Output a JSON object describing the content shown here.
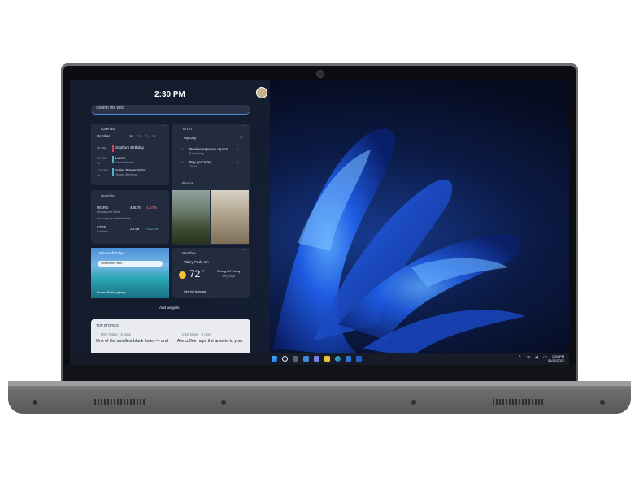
{
  "widgets": {
    "time": "2:30 PM",
    "search_placeholder": "Search the web",
    "calendar": {
      "title": "Calendar",
      "month": "October",
      "dates": [
        "20",
        "21",
        "22",
        "23"
      ],
      "events": [
        {
          "when": "All day",
          "title": "Sophia's Birthday",
          "sub": "",
          "color": "#c8465a"
        },
        {
          "when": "12 PM",
          "dur": "1h",
          "title": "Lunch",
          "sub": "Omar Bennet",
          "color": "#4fb3c9"
        },
        {
          "when": "1:30 PM",
          "dur": "1h",
          "title": "Sales Presentation",
          "sub": "Teams Meeting",
          "color": "#4fb3c9"
        }
      ]
    },
    "todo": {
      "title": "To Do",
      "list": "My Day",
      "items": [
        {
          "title": "Review expense reports",
          "sub": "Expensing"
        },
        {
          "title": "Buy groceries",
          "sub": "Tasks"
        }
      ]
    },
    "watchlist": {
      "title": "Watchlist",
      "stocks": [
        {
          "symbol": "WGRB",
          "name": "Woodgrove Bank",
          "price": "435.75",
          "change": "-1.67%",
          "change_color": "#ff7b7b"
        },
        {
          "symbol": "CTSP",
          "name": "Contoso",
          "price": "23.98",
          "change": "+2.23%",
          "change_color": "#6fd08c"
        }
      ],
      "note": "You may be interested in"
    },
    "photos": {
      "title": "Photos"
    },
    "edge": {
      "title": "Microsoft Edge",
      "search": "Search the web",
      "caption": "Rome (Roets, japan)"
    },
    "weather": {
      "title": "Weather",
      "location": "Valley Park, CA",
      "temp": "72",
      "unit": "°F",
      "condition": "Strong UV Today",
      "sub": "Very high",
      "link": "See full forecast"
    },
    "add_widgets": "Add widgets",
    "stories": {
      "title": "TOP STORIES",
      "items": [
        {
          "source": "USA Today · 3 mins",
          "headline": "One of the smallest black holes — and"
        },
        {
          "source": "CBS News · 5 mins",
          "headline": "Are coffee naps the answer to your"
        }
      ]
    }
  },
  "taskbar": {
    "time": "2:30 PM",
    "date": "01/12/2022"
  }
}
